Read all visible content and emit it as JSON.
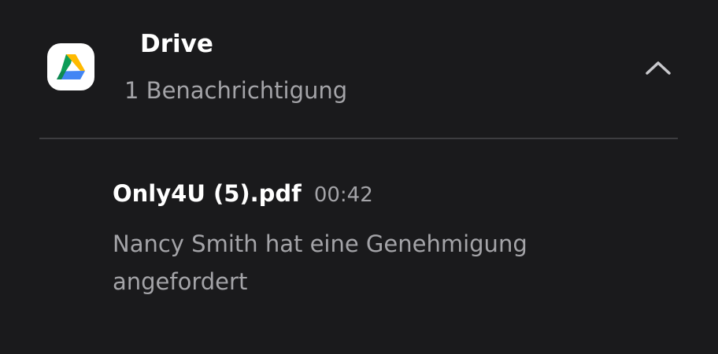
{
  "app": {
    "name": "Drive",
    "notification_count_text": "1 Benachrichtigung",
    "icon": "google-drive-icon"
  },
  "header": {
    "collapse_icon": "chevron-up-icon"
  },
  "notification": {
    "title": "Only4U (5).pdf",
    "time": "00:42",
    "message": "Nancy Smith hat eine Genehmigung angefordert"
  },
  "colors": {
    "background": "#1a1a1c",
    "primary_text": "#ffffff",
    "secondary_text": "#a4a4a8",
    "divider": "#3d3d40",
    "drive_green": "#1ea362",
    "drive_blue": "#4285f4",
    "drive_yellow": "#ffba00",
    "drive_dark_green": "#0d9d58"
  }
}
